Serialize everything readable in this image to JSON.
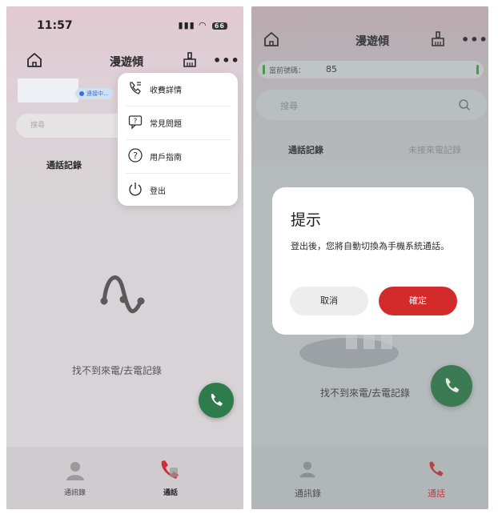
{
  "left": {
    "status": {
      "time": "11:57",
      "battery": "66"
    },
    "header": {
      "title": "漫遊傾"
    },
    "account": {
      "status": "連接中..."
    },
    "search": {
      "placeholder": "搜尋"
    },
    "tabs": {
      "call_log": "通話記錄"
    },
    "menu": [
      {
        "label": "收費詳情",
        "icon": "phone-bill-icon"
      },
      {
        "label": "常見問題",
        "icon": "faq-icon"
      },
      {
        "label": "用戶指南",
        "icon": "help-icon"
      },
      {
        "label": "登出",
        "icon": "power-icon"
      }
    ],
    "empty": {
      "text": "找不到來電/去電記錄"
    },
    "bottom_nav": {
      "contacts": "通訊錄",
      "calls": "通話"
    }
  },
  "right": {
    "header": {
      "title": "漫遊傾"
    },
    "number_chip": {
      "label": "當前號碼：",
      "value": "85"
    },
    "search": {
      "placeholder": "搜尋"
    },
    "tabs": {
      "call_log": "通話記錄",
      "missed": "未接來電記錄"
    },
    "dialog": {
      "title": "提示",
      "message": "登出後，您將自動切換為手機系統通話。",
      "cancel": "取消",
      "confirm": "確定"
    },
    "empty": {
      "text": "找不到來電/去電記錄"
    },
    "bottom_nav": {
      "contacts": "通訊錄",
      "calls": "通話"
    }
  },
  "colors": {
    "accent_red": "#d32b2b",
    "call_green": "#2e7b4b",
    "link_blue": "#3a6fd8"
  }
}
